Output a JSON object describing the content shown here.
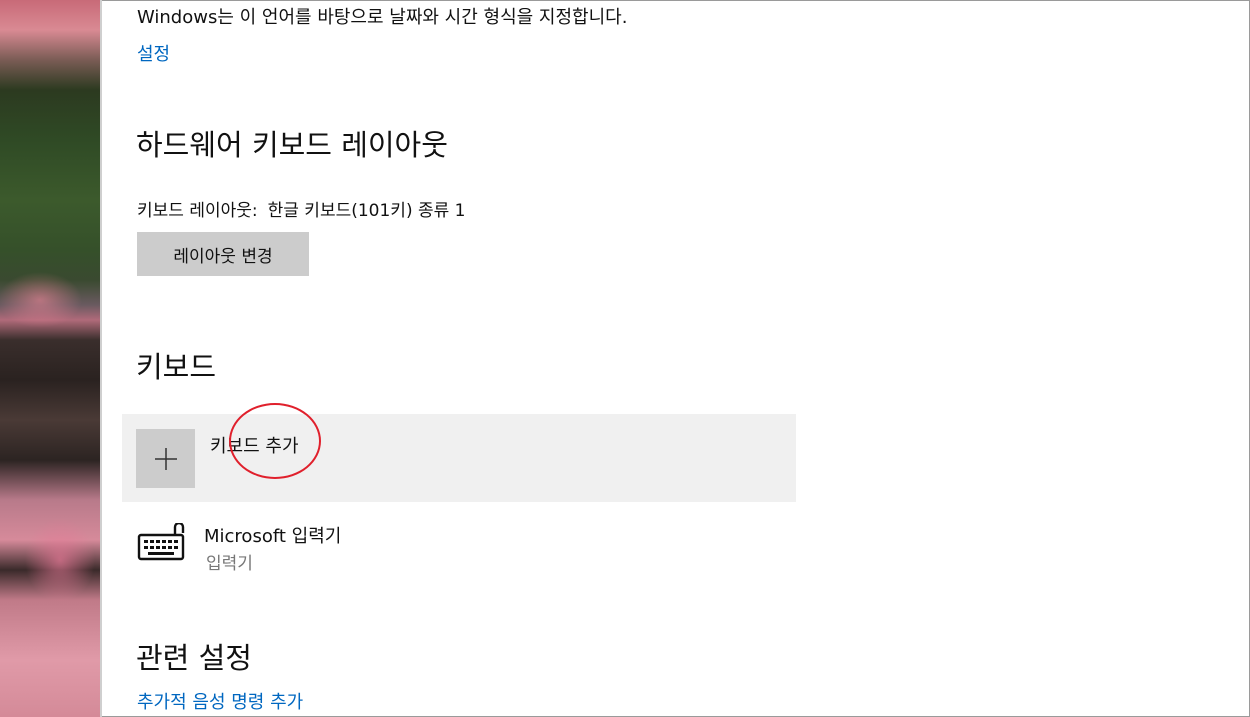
{
  "language": {
    "description": "Windows는 이 언어를 바탕으로 날짜와 시간 형식을 지정합니다.",
    "settings_link": "설정"
  },
  "hardware_layout": {
    "heading": "하드웨어 키보드 레이아웃",
    "label": "키보드 레이아웃:",
    "value": "한글 키보드(101키) 종류 1",
    "change_button": "레이아웃 변경"
  },
  "keyboards": {
    "heading": "키보드",
    "add_label": "키보드 추가",
    "add_icon": "plus-icon",
    "items": [
      {
        "name": "Microsoft 입력기",
        "subtitle": "입력기",
        "icon": "keyboard-icon"
      }
    ]
  },
  "related": {
    "heading": "관련 설정",
    "link": "추가적 음성 명령 추가"
  },
  "colors": {
    "accent": "#0067c0",
    "annotation": "#e0202c",
    "button_bg": "#cccccc",
    "row_bg": "#f0f0f0"
  }
}
